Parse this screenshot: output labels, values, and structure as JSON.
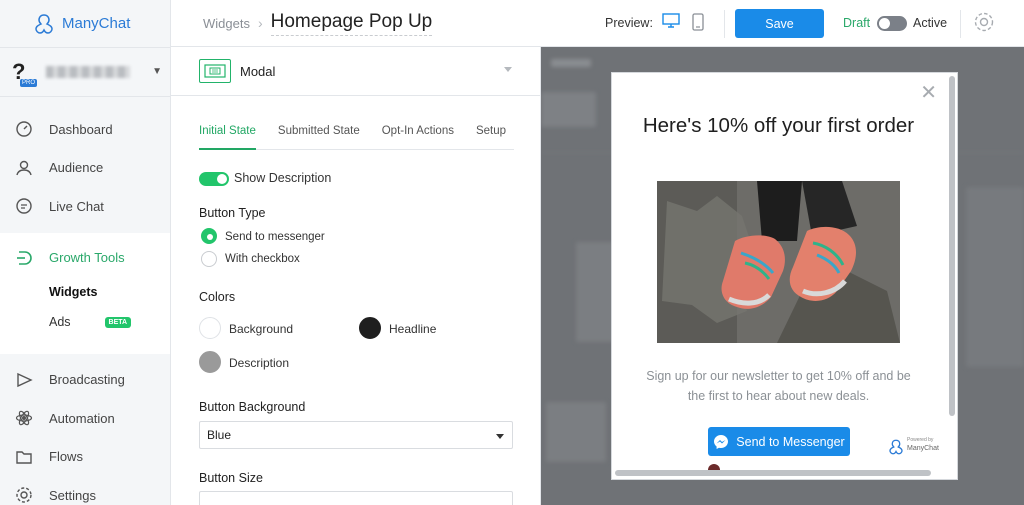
{
  "brand": {
    "name": "ManyChat"
  },
  "account": {
    "badge": "PRO"
  },
  "nav": {
    "items_top": [
      {
        "label": "Dashboard",
        "icon": "gauge-icon"
      },
      {
        "label": "Audience",
        "icon": "user-icon"
      },
      {
        "label": "Live Chat",
        "icon": "chat-icon"
      }
    ],
    "growth": {
      "label": "Growth Tools",
      "icon": "growth-tools-icon"
    },
    "sub": [
      {
        "label": "Widgets"
      },
      {
        "label": "Ads",
        "badge": "BETA"
      }
    ],
    "items_bottom": [
      {
        "label": "Broadcasting",
        "icon": "broadcast-icon"
      },
      {
        "label": "Automation",
        "icon": "automation-icon"
      },
      {
        "label": "Flows",
        "icon": "folder-icon"
      },
      {
        "label": "Settings",
        "icon": "gear-icon"
      }
    ]
  },
  "header": {
    "breadcrumb": "Widgets",
    "title": "Homepage Pop Up",
    "preview_label": "Preview:",
    "save_label": "Save",
    "draft_label": "Draft",
    "active_label": "Active"
  },
  "editor": {
    "widget_type": "Modal",
    "tabs": [
      "Initial State",
      "Submitted State",
      "Opt-In Actions",
      "Setup"
    ],
    "active_tab": "Initial State",
    "show_description_label": "Show Description",
    "show_description": true,
    "button_type_heading": "Button Type",
    "button_type_options": [
      "Send to messenger",
      "With checkbox"
    ],
    "button_type_selected": "Send to messenger",
    "colors_heading": "Colors",
    "colors": [
      {
        "name": "Background",
        "color": "#ffffff"
      },
      {
        "name": "Headline",
        "color": "#1f1f1f"
      },
      {
        "name": "Description",
        "color": "#9a9a9a"
      }
    ],
    "button_background_heading": "Button Background",
    "button_background_value": "Blue",
    "button_size_heading": "Button Size",
    "accent": "#22c56b"
  },
  "modal_preview": {
    "headline": "Here's 10% off your first order",
    "description": "Sign up for our newsletter to get 10% off and be the first to hear about new deals.",
    "button_label": "Send to Messenger",
    "powered_by": "Powered by",
    "powered_brand": "ManyChat",
    "button_color": "#1a8be8"
  }
}
